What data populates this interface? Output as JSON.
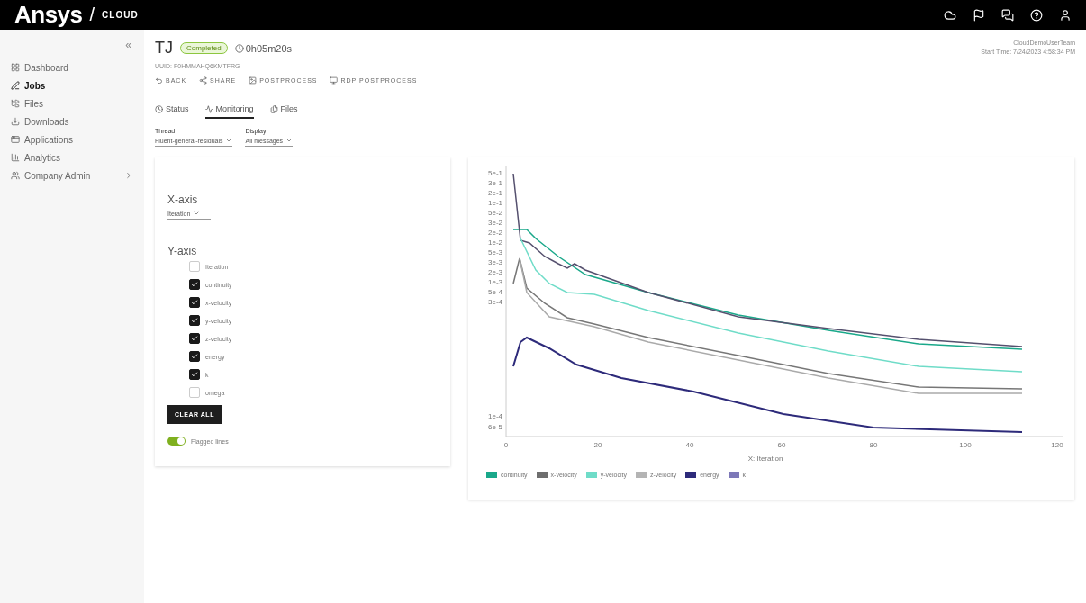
{
  "topbar": {
    "logo": "Ansys",
    "separator": "/",
    "product": "CLOUD"
  },
  "sidebar": {
    "collapse": "«",
    "items": [
      {
        "label": "Dashboard",
        "kind": "link",
        "selected": false
      },
      {
        "label": "Jobs",
        "kind": "link",
        "selected": true
      },
      {
        "label": "Files",
        "kind": "link",
        "selected": false
      },
      {
        "label": "Downloads",
        "kind": "link",
        "selected": false
      },
      {
        "label": "Applications",
        "kind": "link",
        "selected": false
      },
      {
        "label": "Analytics",
        "kind": "link",
        "selected": false
      },
      {
        "label": "Company Admin",
        "kind": "group",
        "selected": false
      }
    ]
  },
  "job": {
    "title": "TJ",
    "status": "Completed",
    "duration": "0h05m20s",
    "uuid": "UUID: F0HMMAHQ6KMTFRG",
    "owner": "CloudDemoUserTeam",
    "start_time": "Start Time: 7/24/2023 4:58:34 PM"
  },
  "actions": [
    "BACK",
    "SHARE",
    "POSTPROCESS",
    "RDP POSTPROCESS"
  ],
  "tabs": [
    {
      "label": "Status",
      "selected": false
    },
    {
      "label": "Monitoring",
      "selected": true
    },
    {
      "label": "Files",
      "selected": false
    }
  ],
  "filters": [
    {
      "label": "Thread",
      "value": "Fluent-general-residuals"
    },
    {
      "label": "Display",
      "value": "All messages"
    }
  ],
  "axes_panel": {
    "x_title": "X-axis",
    "x_value": "Iteration",
    "y_title": "Y-axis",
    "series": [
      {
        "label": "Iteration",
        "checked": false
      },
      {
        "label": "continuity",
        "checked": true
      },
      {
        "label": "x-velocity",
        "checked": true
      },
      {
        "label": "y-velocity",
        "checked": true
      },
      {
        "label": "z-velocity",
        "checked": true
      },
      {
        "label": "energy",
        "checked": true
      },
      {
        "label": "k",
        "checked": true
      },
      {
        "label": "omega",
        "checked": false
      }
    ],
    "clear_button": "CLEAR ALL",
    "toggle": {
      "label": "Flagged lines",
      "on": true
    }
  },
  "plot": {
    "yticks": [
      "5e-1",
      "3e-1",
      "2e-1",
      "1e-1",
      "5e-2",
      "3e-2",
      "2e-2",
      "1e-2",
      "5e-3",
      "3e-3",
      "2e-3",
      "1e-3",
      "5e-4",
      "3e-4",
      "1e-4",
      "6e-5"
    ],
    "xticks": [
      "0",
      "20",
      "40",
      "60",
      "80",
      "100",
      "120"
    ],
    "xlabel": "X: Iteration",
    "legend": [
      {
        "label": "continuity",
        "color": "#1aa88a"
      },
      {
        "label": "x-velocity",
        "color": "#6e6e6e"
      },
      {
        "label": "y-velocity",
        "color": "#6fdcc8"
      },
      {
        "label": "z-velocity",
        "color": "#b4b4b4"
      },
      {
        "label": "energy",
        "color": "#2d2a7a"
      },
      {
        "label": "k",
        "color": "#7d78b8"
      }
    ]
  }
}
